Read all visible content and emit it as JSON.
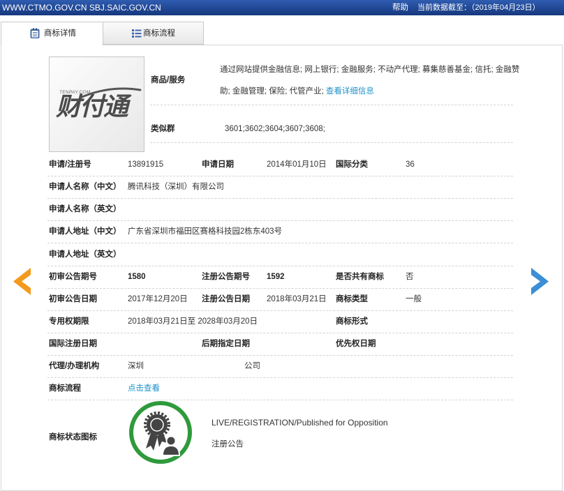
{
  "topbar": {
    "site": "WWW.CTMO.GOV.CN SBJ.SAIC.GOV.CN",
    "help": "帮助",
    "data_date": "当前数据截至：（2019年04月23日）"
  },
  "tabs": [
    {
      "label": "商标详情",
      "icon": "detail-icon",
      "active": true
    },
    {
      "label": "商标流程",
      "icon": "list-icon",
      "active": false
    }
  ],
  "logo": {
    "domain": "TENPAY.COM",
    "name": "财付通"
  },
  "goods": {
    "label": "商品/服务",
    "lines": [
      "通过网站提供金融信息; 网上银行; 金融服务; 不动产代理; 募集慈善基金; 信托; 金融赞",
      "助; 金融管理; 保险; 代管产业;"
    ],
    "link": "查看详细信息"
  },
  "similar_group": {
    "label": "类似群",
    "value": "3601;3602;3604;3607;3608;"
  },
  "rows": [
    {
      "cells": [
        {
          "label": "申请/注册号",
          "value": "13891915"
        },
        {
          "label": "申请日期",
          "value": "2014年01月10日"
        },
        {
          "label": "国际分类",
          "value": "36"
        }
      ]
    },
    {
      "cells": [
        {
          "label": "申请人名称（中文）",
          "value": "腾讯科技（深圳）有限公司"
        }
      ]
    },
    {
      "cells": [
        {
          "label": "申请人名称（英文）"
        }
      ]
    },
    {
      "cells": [
        {
          "label": "申请人地址（中文）",
          "value": "广东省深圳市福田区赛格科技园2栋东403号"
        }
      ]
    },
    {
      "cells": [
        {
          "label": "申请人地址（英文）"
        }
      ]
    },
    {
      "cells": [
        {
          "label": "初审公告期号",
          "value": "1580"
        },
        {
          "label": "注册公告期号",
          "value": "1592"
        },
        {
          "label": "是否共有商标",
          "value": "否"
        }
      ]
    },
    {
      "cells": [
        {
          "label": "初审公告日期",
          "value": "2017年12月20日"
        },
        {
          "label": "注册公告日期",
          "value": "2018年03月21日"
        },
        {
          "label": "商标类型",
          "value": "一般"
        }
      ]
    },
    {
      "cells": [
        {
          "label": "专用权期限",
          "value": "2018年03月21日至 2028年03月20日"
        },
        {
          "label": "商标形式"
        }
      ]
    },
    {
      "cells": [
        {
          "label": "国际注册日期"
        },
        {
          "label": "后期指定日期"
        },
        {
          "label": "优先权日期"
        }
      ]
    },
    {
      "cells": [
        {
          "label": "代理/办理机构",
          "value_start": "深圳",
          "value_end": "公司"
        }
      ]
    },
    {
      "cells": [
        {
          "label": "商标流程",
          "link": "点击查看"
        }
      ]
    }
  ],
  "status": {
    "label": "商标状态图标",
    "icon": "trademark-status-medal-icon",
    "text_en": "LIVE/REGISTRATION/Published for Opposition",
    "text_cn": "注册公告"
  },
  "nav": {
    "prev_icon": "chevron-left-icon",
    "next_icon": "chevron-right-icon"
  },
  "colors": {
    "topbar": "#1f4591",
    "link": "#1e93c9",
    "arrow_prev": "#f39a1e",
    "arrow_next": "#3a8fd6",
    "status_ring": "#2f9a3c"
  }
}
